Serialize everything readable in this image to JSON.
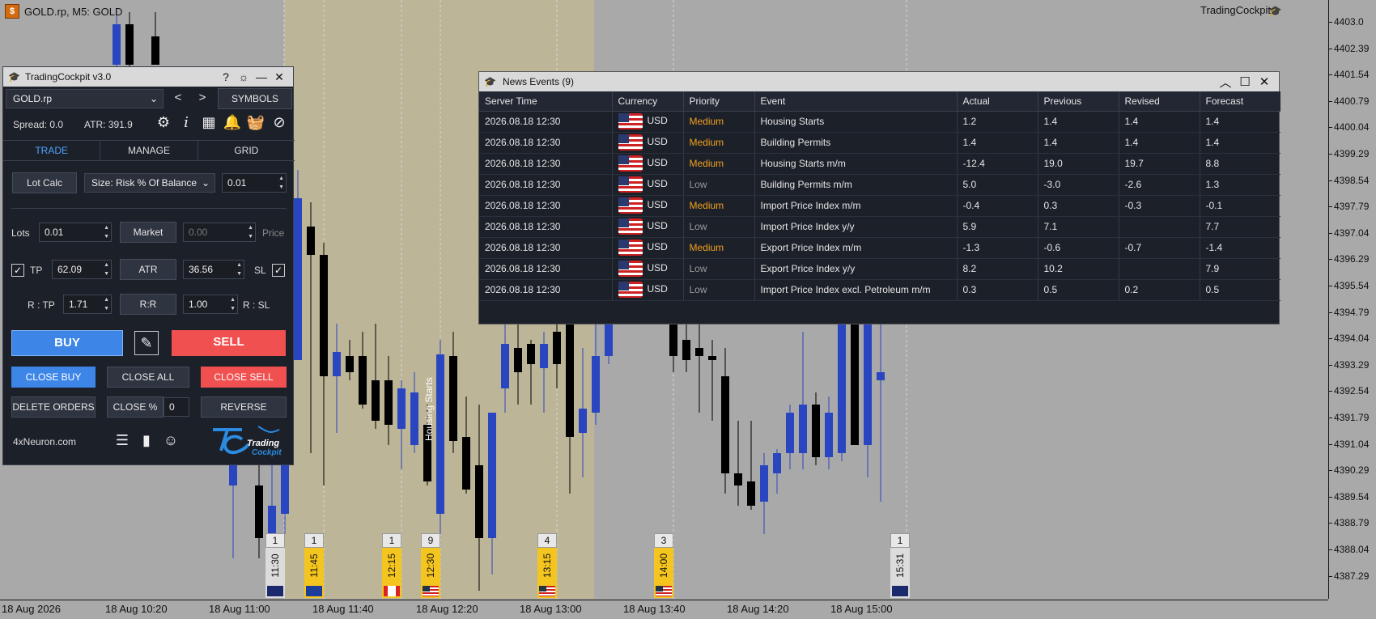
{
  "chart": {
    "symbol_title": "GOLD.rp, M5:  GOLD",
    "brand_label": "TradingCockpit",
    "price_labels": [
      "4403.0",
      "4402.39",
      "4401.54",
      "4400.79",
      "4400.04",
      "4399.29",
      "4398.54",
      "4397.79",
      "4397.04",
      "4396.29",
      "4395.54",
      "4394.79",
      "4394.04",
      "4393.29",
      "4392.54",
      "4391.79",
      "4391.04",
      "4390.29",
      "4389.54",
      "4388.79",
      "4388.04",
      "4387.29"
    ],
    "time_labels": [
      "18 Aug 2026",
      "18 Aug 10:20",
      "18 Aug 11:00",
      "18 Aug 11:40",
      "18 Aug 12:20",
      "18 Aug 13:00",
      "18 Aug 13:40",
      "18 Aug 14:20",
      "18 Aug 15:00"
    ],
    "vertical_annotation": "Housing Starts",
    "news_markers": [
      {
        "count": "1",
        "time": "11:30",
        "flag": "nz",
        "style": "grey"
      },
      {
        "count": "1",
        "time": "11:45",
        "flag": "eu",
        "style": "yellow"
      },
      {
        "count": "1",
        "time": "12:15",
        "flag": "ca",
        "style": "yellow"
      },
      {
        "count": "9",
        "time": "12:30",
        "flag": "us",
        "style": "yellow"
      },
      {
        "count": "4",
        "time": "13:15",
        "flag": "us",
        "style": "yellow"
      },
      {
        "count": "3",
        "time": "14:00",
        "flag": "us",
        "style": "yellow"
      },
      {
        "count": "1",
        "time": "15:31",
        "flag": "nz",
        "style": "grey"
      }
    ]
  },
  "cockpit": {
    "title": "TradingCockpit v3.0",
    "title_buttons": [
      "?",
      "☼",
      "—",
      "✕"
    ],
    "symbol_select": "GOLD.rp",
    "prev_label": "<",
    "next_label": ">",
    "symbols_label": "SYMBOLS",
    "spread": "Spread: 0.0",
    "atr": "ATR: 391.9",
    "tabs": [
      "TRADE",
      "MANAGE",
      "GRID"
    ],
    "lot_calc_label": "Lot Calc",
    "size_select": "Size: Risk % Of Balance",
    "size_value": "0.01",
    "lots_label": "Lots",
    "lots_value": "0.01",
    "market_label": "Market",
    "price_value": "0.00",
    "price_label": "Price",
    "tp_label": "TP",
    "tp_value": "62.09",
    "atr_label": "ATR",
    "atr_value": "36.56",
    "sl_label": "SL",
    "rtp_label": "R : TP",
    "rtp_value": "1.71",
    "rr_label": "R:R",
    "rr_value": "1.00",
    "rsl_label": "R : SL",
    "buy_label": "BUY",
    "sell_label": "SELL",
    "close_buy_label": "CLOSE BUY",
    "close_all_label": "CLOSE ALL",
    "close_sell_label": "CLOSE SELL",
    "delete_orders_label": "DELETE ORDERS",
    "close_pct_label": "CLOSE %",
    "close_pct_value": "0",
    "reverse_label": "REVERSE",
    "website": "4xNeuron.com",
    "logo_text_1": "Trading",
    "logo_text_2": "Cockpit"
  },
  "news": {
    "title": "News Events (9)",
    "columns": [
      "Server Time",
      "Currency",
      "Priority",
      "Event",
      "Actual",
      "Previous",
      "Revised",
      "Forecast"
    ],
    "rows": [
      {
        "time": "2026.08.18 12:30",
        "currency": "USD",
        "priority": "Medium",
        "event": "Housing Starts",
        "actual": "1.2",
        "previous": "1.4",
        "revised": "1.4",
        "forecast": "1.4"
      },
      {
        "time": "2026.08.18 12:30",
        "currency": "USD",
        "priority": "Medium",
        "event": "Building Permits",
        "actual": "1.4",
        "previous": "1.4",
        "revised": "1.4",
        "forecast": "1.4"
      },
      {
        "time": "2026.08.18 12:30",
        "currency": "USD",
        "priority": "Medium",
        "event": "Housing Starts m/m",
        "actual": "-12.4",
        "previous": "19.0",
        "revised": "19.7",
        "forecast": "8.8"
      },
      {
        "time": "2026.08.18 12:30",
        "currency": "USD",
        "priority": "Low",
        "event": "Building Permits m/m",
        "actual": "5.0",
        "previous": "-3.0",
        "revised": "-2.6",
        "forecast": "1.3"
      },
      {
        "time": "2026.08.18 12:30",
        "currency": "USD",
        "priority": "Medium",
        "event": "Import Price Index m/m",
        "actual": "-0.4",
        "previous": "0.3",
        "revised": "-0.3",
        "forecast": "-0.1"
      },
      {
        "time": "2026.08.18 12:30",
        "currency": "USD",
        "priority": "Low",
        "event": "Import Price Index y/y",
        "actual": "5.9",
        "previous": "7.1",
        "revised": "",
        "forecast": "7.7"
      },
      {
        "time": "2026.08.18 12:30",
        "currency": "USD",
        "priority": "Medium",
        "event": "Export Price Index m/m",
        "actual": "-1.3",
        "previous": "-0.6",
        "revised": "-0.7",
        "forecast": "-1.4"
      },
      {
        "time": "2026.08.18 12:30",
        "currency": "USD",
        "priority": "Low",
        "event": "Export Price Index y/y",
        "actual": "8.2",
        "previous": "10.2",
        "revised": "",
        "forecast": "7.9"
      },
      {
        "time": "2026.08.18 12:30",
        "currency": "USD",
        "priority": "Low",
        "event": "Import Price Index excl. Petroleum m/m",
        "actual": "0.3",
        "previous": "0.5",
        "revised": "0.2",
        "forecast": "0.5"
      }
    ]
  },
  "colors": {
    "bull_candle": "#2a45c0",
    "bear_candle": "#000000",
    "session_band": "#bdb597",
    "accent_blue": "#3d86e8",
    "sell_red": "#f05050",
    "medium_priority": "#f0a020"
  }
}
